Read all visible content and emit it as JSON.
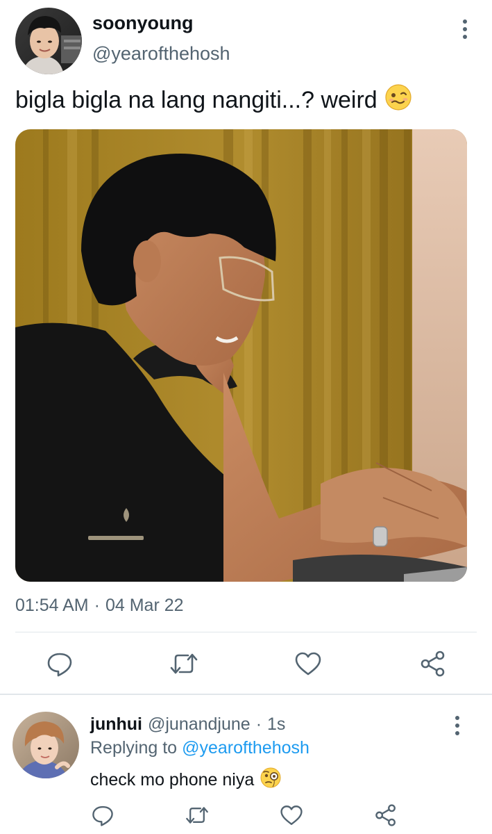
{
  "tweet": {
    "display_name": "soonyoung",
    "handle": "@yearofthehosh",
    "text": "bigla bigla na lang nangiti...? weird",
    "text_emoji": "woozy-face",
    "time": "01:54 AM",
    "separator": "·",
    "date": "04 Mar 22",
    "actions": [
      "reply",
      "retweet",
      "like",
      "share"
    ]
  },
  "reply": {
    "display_name": "junhui",
    "handle": "@junandjune",
    "separator": "·",
    "age": "1s",
    "replying_prefix": "Replying to",
    "replying_handle": "@yearofthehosh",
    "text": "check mo phone niya",
    "text_emoji": "face-with-monocle",
    "actions": [
      "reply",
      "retweet",
      "like",
      "share"
    ]
  },
  "colors": {
    "text_primary": "#0f1419",
    "text_secondary": "#536471",
    "link": "#1d9bf0",
    "divider": "#e1e6ea"
  }
}
